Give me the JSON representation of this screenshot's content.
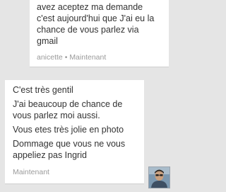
{
  "received_message": {
    "lines": [
      "avez aceptez ma demande",
      "c'est aujourd'hui que J'ai eu la",
      "chance de vous parlez via",
      "gmail"
    ],
    "sender": "anicette",
    "separator": "•",
    "time": "Maintenant"
  },
  "sent_message": {
    "paragraphs": [
      "C'est très gentil",
      "J'ai beaucoup de chance de vous parlez moi aussi.",
      "Vous etes très jolie en photo",
      "Dommage que vous ne vous appeliez pas Ingrid"
    ],
    "time": "Maintenant"
  },
  "avatar": {
    "icon": "user-photo-avatar"
  }
}
